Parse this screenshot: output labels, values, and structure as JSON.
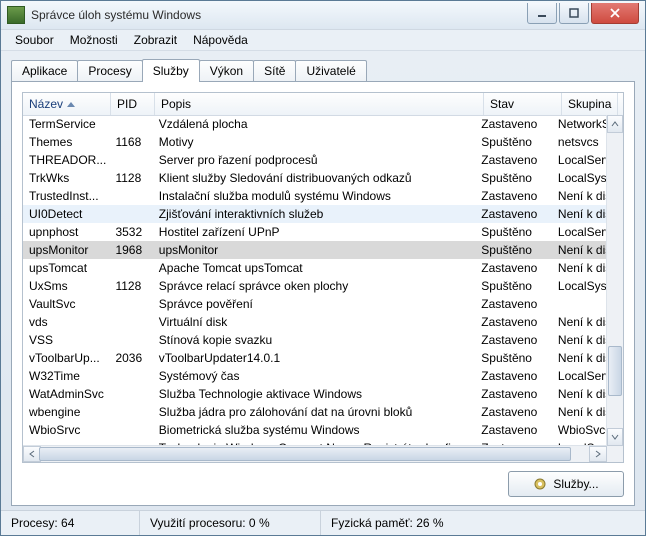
{
  "window": {
    "title": "Správce úloh systému Windows"
  },
  "menu": {
    "items": [
      "Soubor",
      "Možnosti",
      "Zobrazit",
      "Nápověda"
    ]
  },
  "tabs": {
    "items": [
      "Aplikace",
      "Procesy",
      "Služby",
      "Výkon",
      "Sítě",
      "Uživatelé"
    ],
    "active_index": 2
  },
  "columns": [
    {
      "label": "Název",
      "sorted": true
    },
    {
      "label": "PID"
    },
    {
      "label": "Popis"
    },
    {
      "label": "Stav"
    },
    {
      "label": "Skupina"
    }
  ],
  "rows": [
    {
      "name": "TermService",
      "pid": "",
      "desc": "Vzdálená plocha",
      "state": "Zastaveno",
      "group": "NetworkService",
      "blue": false
    },
    {
      "name": "Themes",
      "pid": "1168",
      "desc": "Motivy",
      "state": "Spuštěno",
      "group": "netsvcs",
      "blue": false
    },
    {
      "name": "THREADOR...",
      "pid": "",
      "desc": "Server pro řazení podprocesů",
      "state": "Zastaveno",
      "group": "LocalService",
      "blue": false
    },
    {
      "name": "TrkWks",
      "pid": "1128",
      "desc": "Klient služby Sledování distribuovaných odkazů",
      "state": "Spuštěno",
      "group": "LocalSystem",
      "blue": false
    },
    {
      "name": "TrustedInst...",
      "pid": "",
      "desc": "Instalační služba modulů systému Windows",
      "state": "Zastaveno",
      "group": "Není k dispozici",
      "blue": false
    },
    {
      "name": "UI0Detect",
      "pid": "",
      "desc": "Zjišťování interaktivních služeb",
      "state": "Zastaveno",
      "group": "Není k dispozici",
      "blue": true
    },
    {
      "name": "upnphost",
      "pid": "3532",
      "desc": "Hostitel zařízení UPnP",
      "state": "Spuštěno",
      "group": "LocalService",
      "blue": false
    },
    {
      "name": "upsMonitor",
      "pid": "1968",
      "desc": "upsMonitor",
      "state": "Spuštěno",
      "group": "Není k dispozici",
      "blue": false,
      "selected": true
    },
    {
      "name": "upsTomcat",
      "pid": "",
      "desc": "Apache Tomcat upsTomcat",
      "state": "Zastaveno",
      "group": "Není k dispozici",
      "blue": false
    },
    {
      "name": "UxSms",
      "pid": "1128",
      "desc": "Správce relací správce oken plochy",
      "state": "Spuštěno",
      "group": "LocalSystem",
      "blue": false
    },
    {
      "name": "VaultSvc",
      "pid": "",
      "desc": "Správce pověření",
      "state": "Zastaveno",
      "group": "",
      "blue": false
    },
    {
      "name": "vds",
      "pid": "",
      "desc": "Virtuální disk",
      "state": "Zastaveno",
      "group": "Není k dispozici",
      "blue": false
    },
    {
      "name": "VSS",
      "pid": "",
      "desc": "Stínová kopie svazku",
      "state": "Zastaveno",
      "group": "Není k dispozici",
      "blue": false
    },
    {
      "name": "vToolbarUp...",
      "pid": "2036",
      "desc": "vToolbarUpdater14.0.1",
      "state": "Spuštěno",
      "group": "Není k dispozici",
      "blue": false
    },
    {
      "name": "W32Time",
      "pid": "",
      "desc": "Systémový čas",
      "state": "Zastaveno",
      "group": "LocalService",
      "blue": false
    },
    {
      "name": "WatAdminSvc",
      "pid": "",
      "desc": "Služba Technologie aktivace Windows",
      "state": "Zastaveno",
      "group": "Není k dispozici",
      "blue": false
    },
    {
      "name": "wbengine",
      "pid": "",
      "desc": "Služba jádra pro zálohování dat na úrovni bloků",
      "state": "Zastaveno",
      "group": "Není k dispozici",
      "blue": false
    },
    {
      "name": "WbioSrvc",
      "pid": "",
      "desc": "Biometrická služba systému Windows",
      "state": "Zastaveno",
      "group": "WbioSvcGroup",
      "blue": false
    },
    {
      "name": "wcncsvc",
      "pid": "",
      "desc": "Technologie Windows Connect Now – Registrátor konfigurací",
      "state": "Zastaveno",
      "group": "LocalService",
      "blue": false
    }
  ],
  "scrollbar": {
    "vthumb_top_pct": 72,
    "vthumb_height_pct": 16,
    "hthumb_left_pct": 0,
    "hthumb_width_pct": 96
  },
  "footer_button": "Služby...",
  "status": {
    "processes": "Procesy: 64",
    "cpu": "Využití procesoru: 0 %",
    "mem": "Fyzická paměť: 26 %"
  }
}
